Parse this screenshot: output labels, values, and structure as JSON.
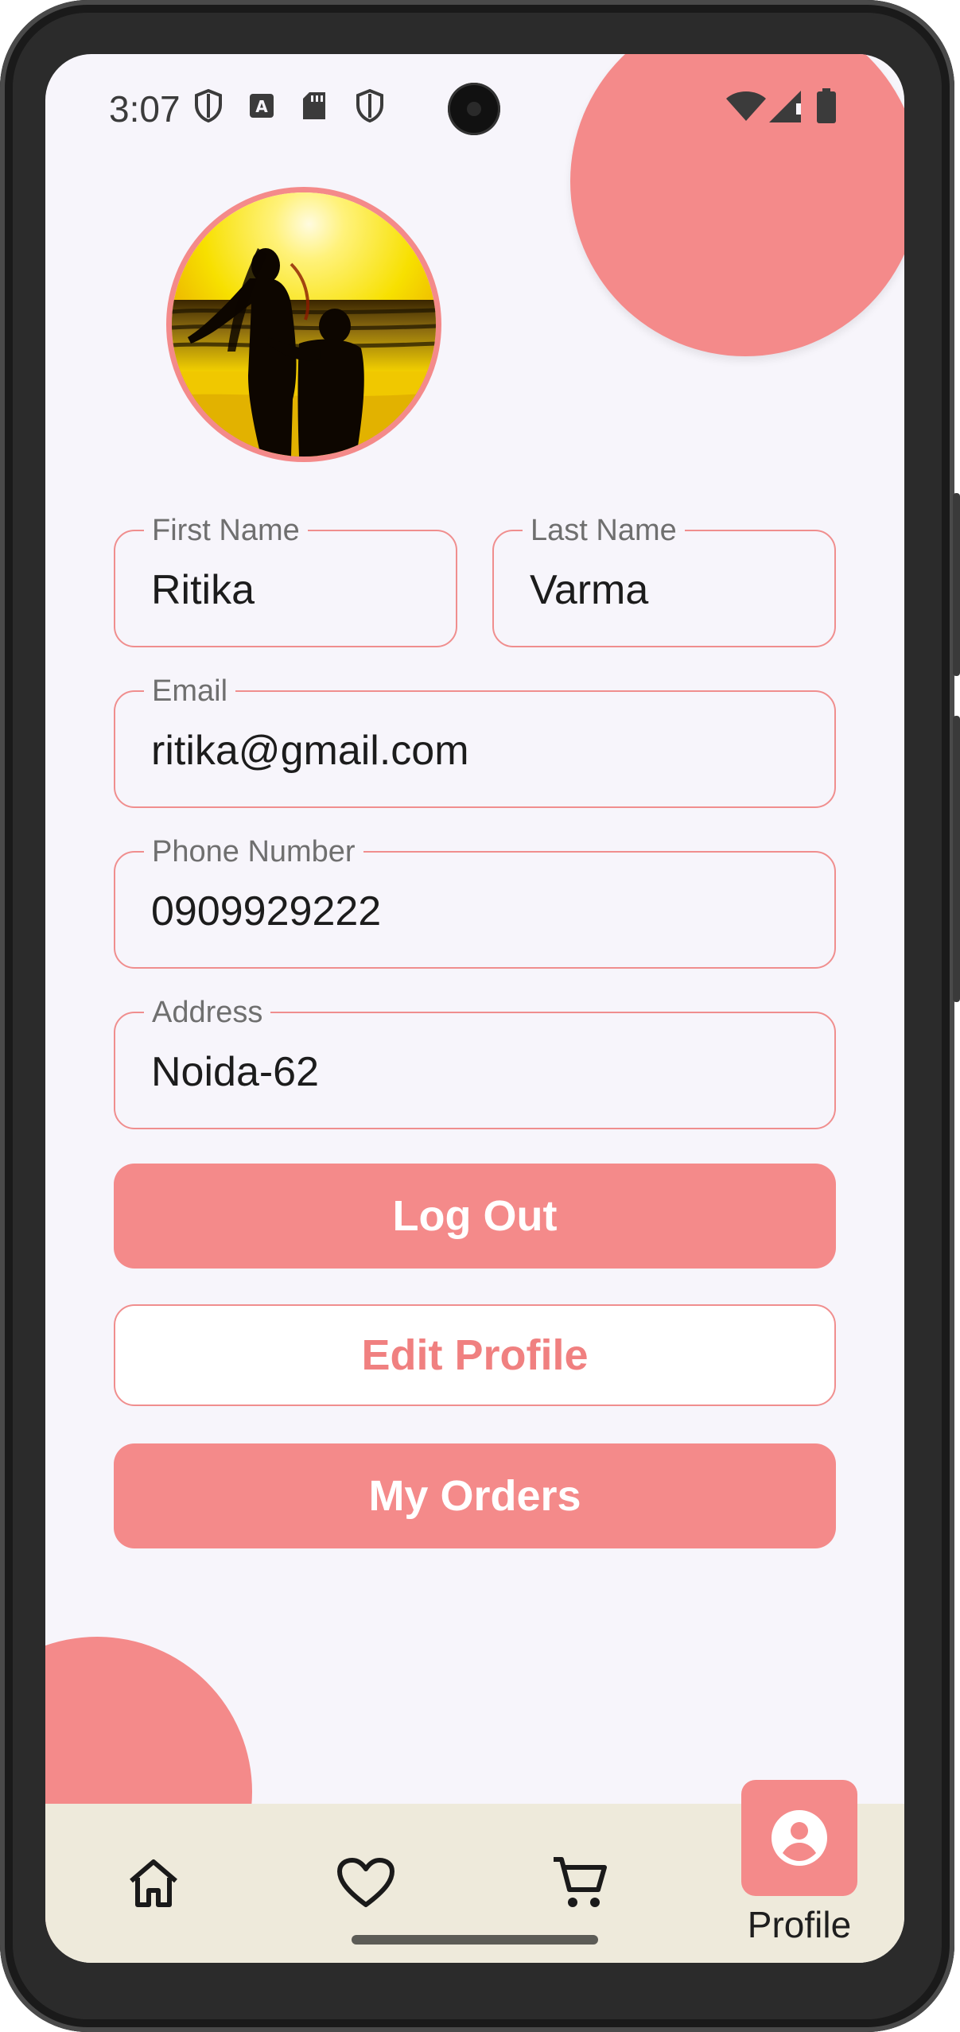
{
  "status_bar": {
    "time": "3:07"
  },
  "profile": {
    "first_name": {
      "label": "First Name",
      "value": "Ritika"
    },
    "last_name": {
      "label": "Last Name",
      "value": "Varma"
    },
    "email": {
      "label": "Email",
      "value": "ritika@gmail.com"
    },
    "phone": {
      "label": "Phone Number",
      "value": "0909929222"
    },
    "address": {
      "label": "Address",
      "value": "Noida-62"
    }
  },
  "actions": {
    "logout": "Log Out",
    "edit_profile": "Edit Profile",
    "my_orders": "My Orders"
  },
  "bottom_nav": {
    "items": [
      {
        "icon": "home-icon"
      },
      {
        "icon": "heart-icon"
      },
      {
        "icon": "cart-icon"
      },
      {
        "icon": "account-circle-icon",
        "label": "Profile",
        "active": true
      }
    ]
  },
  "colors": {
    "accent": "#f48a8a",
    "background": "#f7f5fb",
    "navbar": "#eeeadb"
  }
}
